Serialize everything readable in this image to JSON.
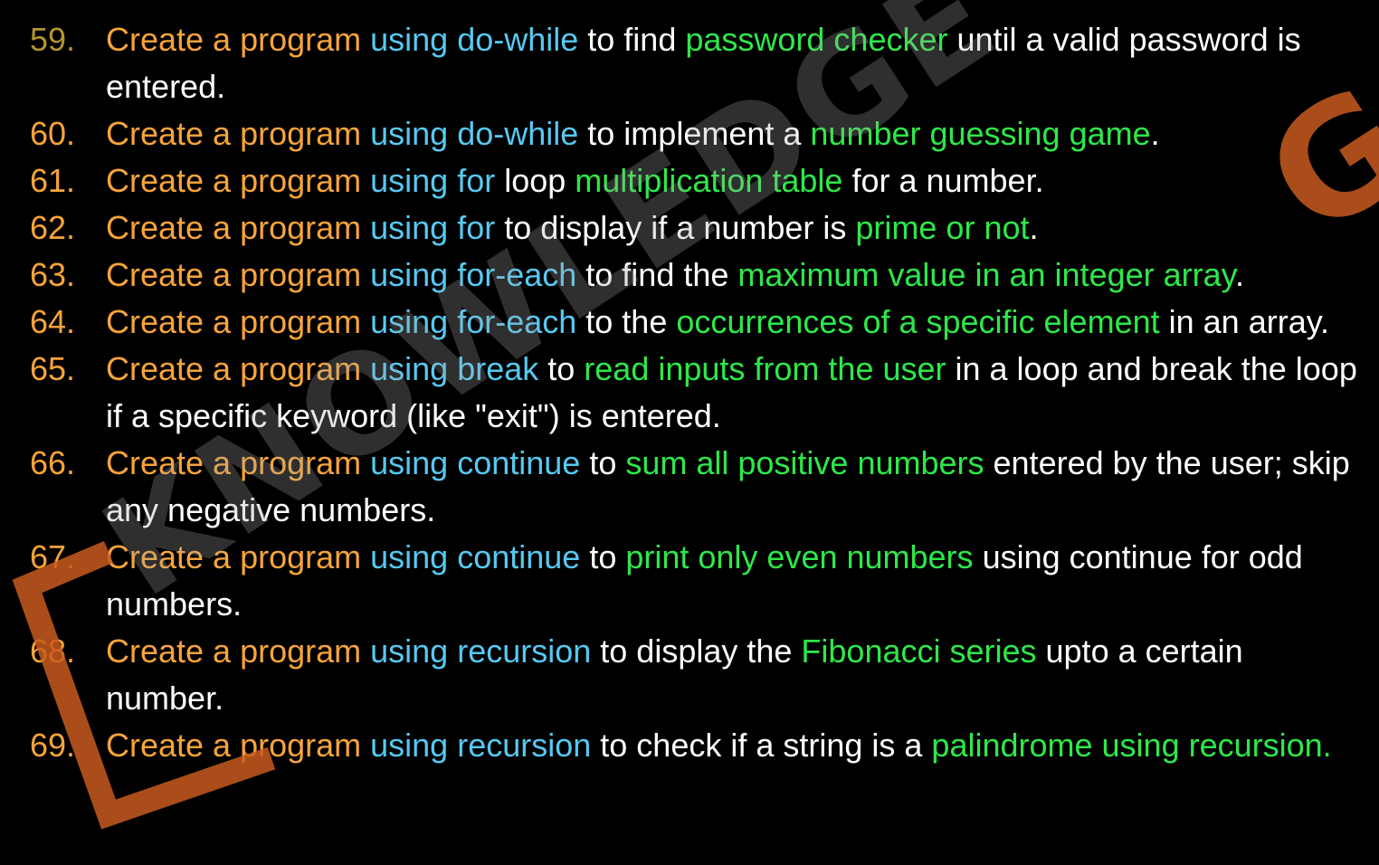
{
  "items": [
    {
      "number": "59.",
      "segments": [
        {
          "text": "Create a program ",
          "color": "orange"
        },
        {
          "text": "using do-while",
          "color": "blue"
        },
        {
          "text": " to find ",
          "color": "white"
        },
        {
          "text": "password checker",
          "color": "green"
        },
        {
          "text": " until a valid password is entered.",
          "color": "white"
        }
      ]
    },
    {
      "number": "60.",
      "segments": [
        {
          "text": "Create a program ",
          "color": "orange"
        },
        {
          "text": "using do-while",
          "color": "blue"
        },
        {
          "text": " to implement a ",
          "color": "white"
        },
        {
          "text": "number guessing game",
          "color": "green"
        },
        {
          "text": ".",
          "color": "white"
        }
      ]
    },
    {
      "number": "61.",
      "segments": [
        {
          "text": "Create a program ",
          "color": "orange"
        },
        {
          "text": "using for",
          "color": "blue"
        },
        {
          "text": " loop ",
          "color": "white"
        },
        {
          "text": "multiplication table",
          "color": "green"
        },
        {
          "text": " for a number.",
          "color": "white"
        }
      ]
    },
    {
      "number": "62.",
      "segments": [
        {
          "text": "Create a program ",
          "color": "orange"
        },
        {
          "text": "using for",
          "color": "blue"
        },
        {
          "text": " to display if a number is ",
          "color": "white"
        },
        {
          "text": "prime or not",
          "color": "green"
        },
        {
          "text": ".",
          "color": "white"
        }
      ]
    },
    {
      "number": "63.",
      "segments": [
        {
          "text": "Create a program ",
          "color": "orange"
        },
        {
          "text": "using for-each",
          "color": "blue"
        },
        {
          "text": " to find the ",
          "color": "white"
        },
        {
          "text": "maximum value in an integer array",
          "color": "green"
        },
        {
          "text": ".",
          "color": "white"
        }
      ]
    },
    {
      "number": "64.",
      "segments": [
        {
          "text": "Create a program ",
          "color": "orange"
        },
        {
          "text": "using for-each",
          "color": "blue"
        },
        {
          "text": " to the ",
          "color": "white"
        },
        {
          "text": "occurrences of a specific element",
          "color": "green"
        },
        {
          "text": " in an array.",
          "color": "white"
        }
      ]
    },
    {
      "number": "65.",
      "segments": [
        {
          "text": "Create a program ",
          "color": "orange"
        },
        {
          "text": "using break",
          "color": "blue"
        },
        {
          "text": " to ",
          "color": "white"
        },
        {
          "text": "read inputs from the user",
          "color": "green"
        },
        {
          "text": " in a loop and break the loop if a specific keyword (like \"exit\") is entered.",
          "color": "white"
        }
      ]
    },
    {
      "number": "66.",
      "segments": [
        {
          "text": "Create a program ",
          "color": "orange"
        },
        {
          "text": "using continue",
          "color": "blue"
        },
        {
          "text": " to ",
          "color": "white"
        },
        {
          "text": "sum all positive numbers",
          "color": "green"
        },
        {
          "text": " entered by the user; skip any negative numbers.",
          "color": "white"
        }
      ]
    },
    {
      "number": "67.",
      "segments": [
        {
          "text": "Create a program ",
          "color": "orange"
        },
        {
          "text": "using continue",
          "color": "blue"
        },
        {
          "text": " to ",
          "color": "white"
        },
        {
          "text": "print only even numbers",
          "color": "green"
        },
        {
          "text": " using continue for odd numbers.",
          "color": "white"
        }
      ]
    },
    {
      "number": "68.",
      "segments": [
        {
          "text": "Create a program ",
          "color": "orange"
        },
        {
          "text": "using recursion",
          "color": "blue"
        },
        {
          "text": " to display the ",
          "color": "white"
        },
        {
          "text": "Fibonacci series",
          "color": "green"
        },
        {
          "text": " upto a certain number.",
          "color": "white"
        }
      ]
    },
    {
      "number": "69.",
      "segments": [
        {
          "text": "Create a program ",
          "color": "orange"
        },
        {
          "text": "using recursion",
          "color": "blue"
        },
        {
          "text": " to check if a string is a ",
          "color": "white"
        },
        {
          "text": "palindrome using recursion.",
          "color": "green"
        }
      ]
    }
  ],
  "watermark": {
    "text": "KNOWLEDGE",
    "accent_letter": "G"
  },
  "colors": {
    "background": "#000000",
    "orange": "#F7A43A",
    "blue": "#56C9F2",
    "green": "#2EE84A",
    "white": "#FFFFFF",
    "first_number": "#B59431",
    "watermark_accent": "#C85A1E"
  }
}
